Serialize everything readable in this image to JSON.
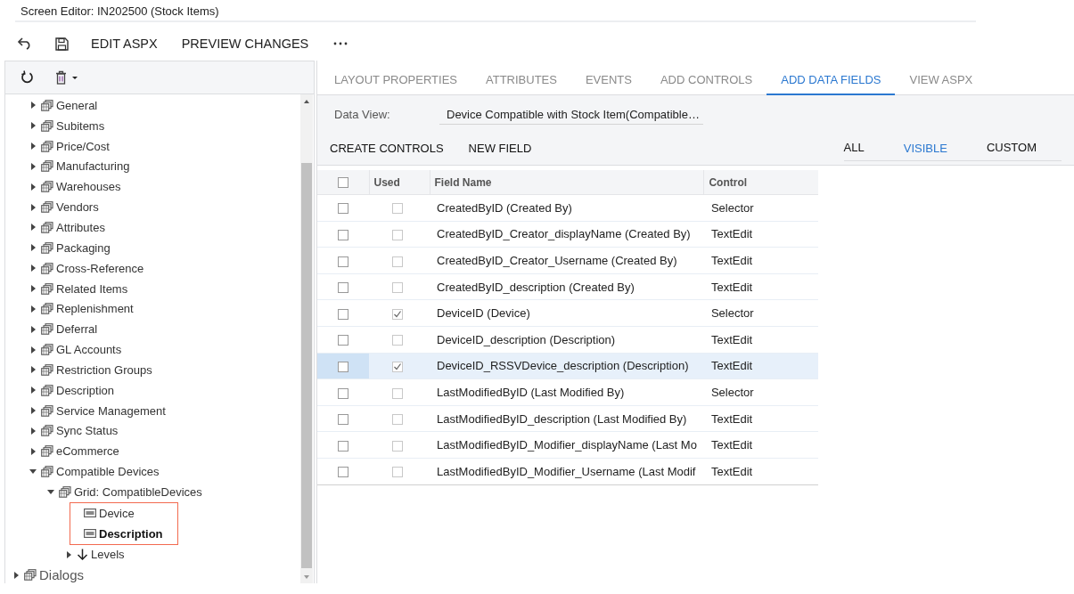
{
  "window": {
    "title": "Screen Editor: IN202500 (Stock Items)"
  },
  "toolbar": {
    "buttons": [
      {
        "kind": "undo"
      },
      {
        "kind": "save"
      },
      {
        "kind": "text",
        "label": "EDIT ASPX"
      },
      {
        "kind": "text",
        "label": "PREVIEW CHANGES"
      },
      {
        "kind": "more"
      }
    ]
  },
  "tree_toolbar": {
    "buttons": [
      {
        "kind": "refresh"
      },
      {
        "kind": "delete"
      }
    ]
  },
  "tree": {
    "items": [
      {
        "label": "General",
        "kind": "container",
        "expanded": false,
        "selected": false
      },
      {
        "label": "Subitems",
        "kind": "container",
        "expanded": false,
        "selected": false
      },
      {
        "label": "Price/Cost",
        "kind": "container",
        "expanded": false,
        "selected": false
      },
      {
        "label": "Manufacturing",
        "kind": "container",
        "expanded": false,
        "selected": false
      },
      {
        "label": "Warehouses",
        "kind": "container",
        "expanded": false,
        "selected": false
      },
      {
        "label": "Vendors",
        "kind": "container",
        "expanded": false,
        "selected": false
      },
      {
        "label": "Attributes",
        "kind": "container",
        "expanded": false,
        "selected": false
      },
      {
        "label": "Packaging",
        "kind": "container",
        "expanded": false,
        "selected": false
      },
      {
        "label": "Cross-Reference",
        "kind": "container",
        "expanded": false,
        "selected": false
      },
      {
        "label": "Related Items",
        "kind": "container",
        "expanded": false,
        "selected": false
      },
      {
        "label": "Replenishment",
        "kind": "container",
        "expanded": false,
        "selected": false
      },
      {
        "label": "Deferral",
        "kind": "container",
        "expanded": false,
        "selected": false
      },
      {
        "label": "GL Accounts",
        "kind": "container",
        "expanded": false,
        "selected": false
      },
      {
        "label": "Restriction Groups",
        "kind": "container",
        "expanded": false,
        "selected": false
      },
      {
        "label": "Description",
        "kind": "container",
        "expanded": false,
        "selected": false
      },
      {
        "label": "Service Management",
        "kind": "container",
        "expanded": false,
        "selected": false
      },
      {
        "label": "Sync Status",
        "kind": "container",
        "expanded": false,
        "selected": false
      },
      {
        "label": "eCommerce",
        "kind": "container",
        "expanded": false,
        "selected": false
      },
      {
        "label": "Compatible Devices",
        "kind": "container",
        "expanded": true,
        "selected": false,
        "children": [
          {
            "label": "Grid: CompatibleDevices",
            "kind": "container",
            "expanded": true,
            "selected": false,
            "children": [
              {
                "label": "Device",
                "kind": "field",
                "highlighted": true,
                "selected": false
              },
              {
                "label": "Description",
                "kind": "field",
                "highlighted": true,
                "selected": true
              },
              {
                "label": "Levels",
                "kind": "relation",
                "expanded": false,
                "selected": false
              }
            ]
          }
        ]
      },
      {
        "label": "Dialogs",
        "kind": "section",
        "expanded": false,
        "selected": false
      }
    ]
  },
  "tabs": [
    {
      "label": "LAYOUT PROPERTIES",
      "selected": false
    },
    {
      "label": "ATTRIBUTES",
      "selected": false
    },
    {
      "label": "EVENTS",
      "selected": false
    },
    {
      "label": "ADD CONTROLS",
      "selected": false
    },
    {
      "label": "ADD DATA FIELDS",
      "selected": true
    },
    {
      "label": "VIEW ASPX",
      "selected": false
    }
  ],
  "form": {
    "data_view_label": "Data View:",
    "data_view_value": "Device Compatible with Stock Item(Compatible…"
  },
  "actions": [
    "CREATE CONTROLS",
    "NEW FIELD"
  ],
  "filters": [
    {
      "label": "ALL",
      "selected": false
    },
    {
      "label": "VISIBLE",
      "selected": true
    },
    {
      "label": "CUSTOM",
      "selected": false
    }
  ],
  "grid": {
    "select_all": false,
    "columns": [
      "Used",
      "Field Name",
      "Control"
    ],
    "rows": [
      {
        "checked": false,
        "used": false,
        "field_name": "CreatedByID (Created By)",
        "control": "Selector",
        "selected": false
      },
      {
        "checked": false,
        "used": false,
        "field_name": "CreatedByID_Creator_displayName (Created By)",
        "control": "TextEdit",
        "selected": false
      },
      {
        "checked": false,
        "used": false,
        "field_name": "CreatedByID_Creator_Username (Created By)",
        "control": "TextEdit",
        "selected": false
      },
      {
        "checked": false,
        "used": false,
        "field_name": "CreatedByID_description (Created By)",
        "control": "TextEdit",
        "selected": false
      },
      {
        "checked": false,
        "used": true,
        "field_name": "DeviceID (Device)",
        "control": "Selector",
        "selected": false
      },
      {
        "checked": false,
        "used": false,
        "field_name": "DeviceID_description (Description)",
        "control": "TextEdit",
        "selected": false
      },
      {
        "checked": false,
        "used": true,
        "field_name": "DeviceID_RSSVDevice_description (Description)",
        "control": "TextEdit",
        "selected": true
      },
      {
        "checked": false,
        "used": false,
        "field_name": "LastModifiedByID (Last Modified By)",
        "control": "Selector",
        "selected": false
      },
      {
        "checked": false,
        "used": false,
        "field_name": "LastModifiedByID_description (Last Modified By)",
        "control": "TextEdit",
        "selected": false
      },
      {
        "checked": false,
        "used": false,
        "field_name": "LastModifiedByID_Modifier_displayName (Last Mo",
        "control": "TextEdit",
        "selected": false
      },
      {
        "checked": false,
        "used": false,
        "field_name": "LastModifiedByID_Modifier_Username (Last Modif",
        "control": "TextEdit",
        "selected": false
      }
    ]
  }
}
